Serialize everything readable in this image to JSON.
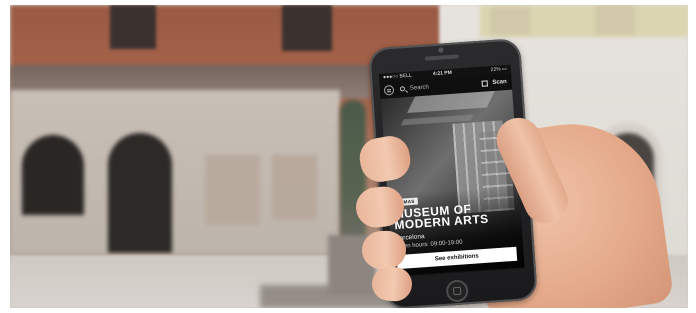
{
  "phone": {
    "status": {
      "carrier": "●●●○○ BELL",
      "time": "4:21 PM",
      "battery": "22% ▭"
    },
    "search": {
      "placeholder": "Search"
    },
    "scan": {
      "label": "Scan"
    },
    "museum": {
      "tag": "MOMAS",
      "title": "MUSEUM OF MODERN ARTS",
      "city": "Barcelona",
      "hours": "Open hours: 09:00-19:00",
      "cta": "See exhibitions"
    }
  }
}
